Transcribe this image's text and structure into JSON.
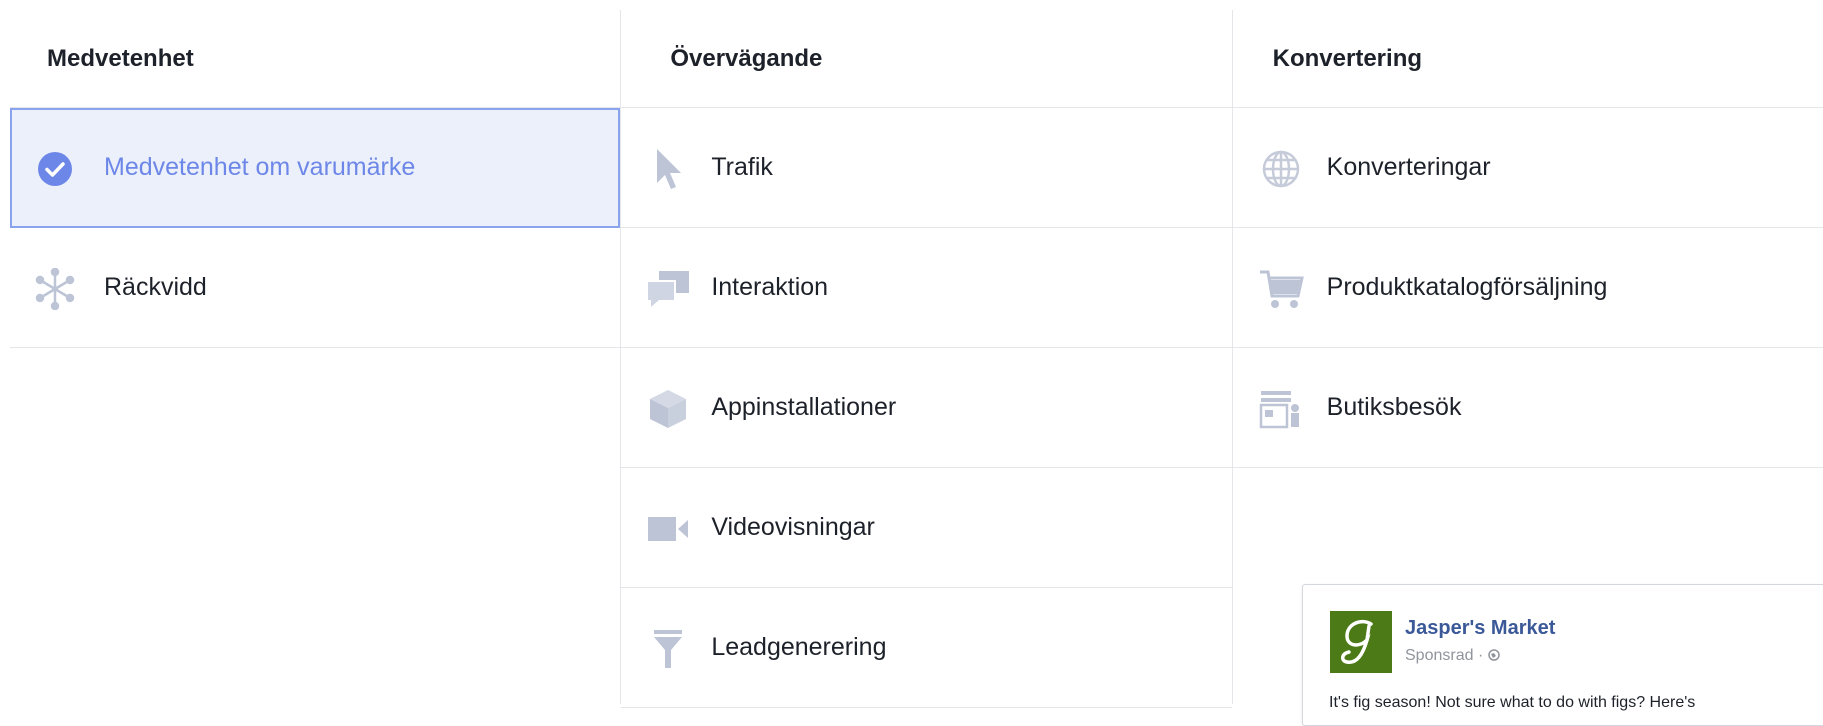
{
  "columns": [
    {
      "header": "Medvetenhet",
      "options": [
        {
          "label": "Medvetenhet om varumärke",
          "icon": "check-circle-icon",
          "selected": true
        },
        {
          "label": "Räckvidd",
          "icon": "reach-icon",
          "selected": false
        }
      ]
    },
    {
      "header": "Övervägande",
      "options": [
        {
          "label": "Trafik",
          "icon": "cursor-icon",
          "selected": false
        },
        {
          "label": "Interaktion",
          "icon": "chat-bubbles-icon",
          "selected": false
        },
        {
          "label": "Appinstallationer",
          "icon": "box-icon",
          "selected": false
        },
        {
          "label": "Videovisningar",
          "icon": "video-camera-icon",
          "selected": false
        },
        {
          "label": "Leadgenerering",
          "icon": "funnel-icon",
          "selected": false
        }
      ]
    },
    {
      "header": "Konvertering",
      "options": [
        {
          "label": "Konverteringar",
          "icon": "globe-icon",
          "selected": false
        },
        {
          "label": "Produktkatalogförsäljning",
          "icon": "cart-icon",
          "selected": false
        },
        {
          "label": "Butiksbesök",
          "icon": "store-icon",
          "selected": false
        }
      ]
    }
  ],
  "ad_preview": {
    "page_name": "Jasper's Market",
    "sponsored": "Sponsrad · ",
    "text": "It's fig season! Not sure what to do with figs? Here's"
  },
  "colors": {
    "selected_bg": "#ecf0fb",
    "selected_border": "#8ba3ec",
    "selected_text": "#6d87e8",
    "icon_gray": "#bcc4d6",
    "link_blue": "#3b5998",
    "logo_green": "#4b7a16"
  }
}
